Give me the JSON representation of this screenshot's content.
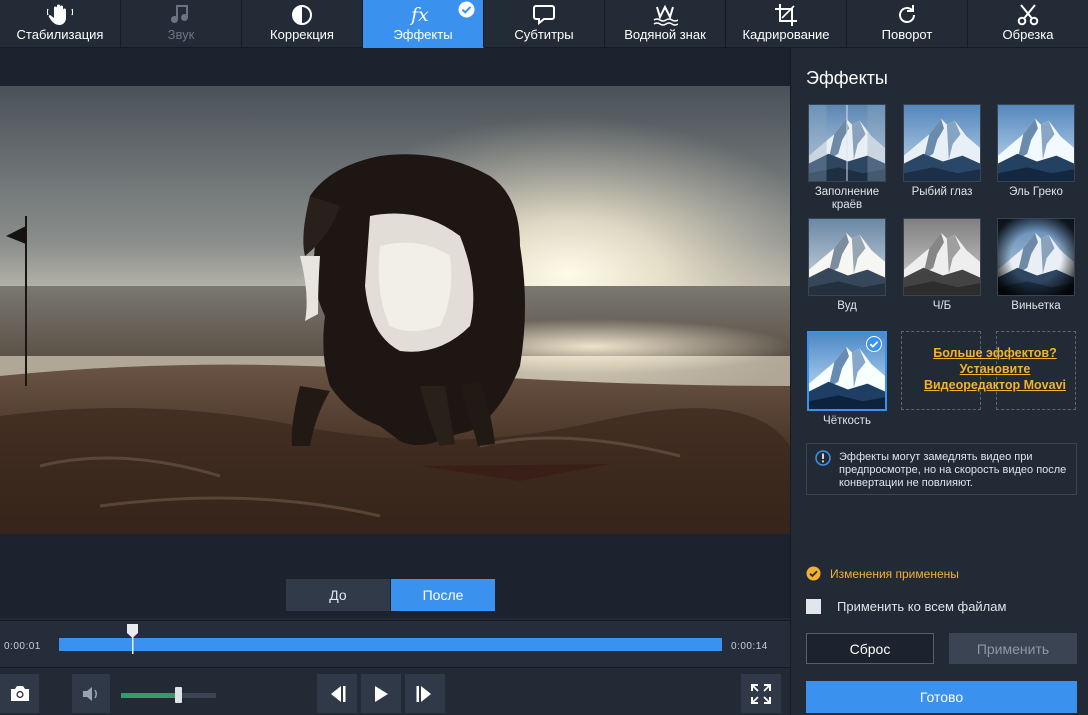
{
  "toolbar": {
    "tabs": [
      {
        "label": "Стабилизация",
        "icon": "hand-icon",
        "state": "normal"
      },
      {
        "label": "Звук",
        "icon": "music-note-icon",
        "state": "disabled"
      },
      {
        "label": "Коррекция",
        "icon": "contrast-icon",
        "state": "normal"
      },
      {
        "label": "Эффекты",
        "icon": "fx-icon",
        "state": "active"
      },
      {
        "label": "Субтитры",
        "icon": "speech-bubble-icon",
        "state": "normal"
      },
      {
        "label": "Водяной знак",
        "icon": "watermark-icon",
        "state": "normal"
      },
      {
        "label": "Кадрирование",
        "icon": "crop-icon",
        "state": "normal"
      },
      {
        "label": "Поворот",
        "icon": "rotate-icon",
        "state": "normal"
      },
      {
        "label": "Обрезка",
        "icon": "scissors-icon",
        "state": "normal"
      }
    ]
  },
  "preview": {
    "before_label": "До",
    "after_label": "После"
  },
  "timeline": {
    "time_start": "0:00:01",
    "time_end": "0:00:14",
    "playhead_fraction": 0.11
  },
  "controls": {
    "volume_fraction": 0.6
  },
  "panel": {
    "title": "Эффекты",
    "effects": [
      {
        "label": "Заполнение краёв",
        "selected": false
      },
      {
        "label": "Рыбий глаз",
        "selected": false
      },
      {
        "label": "Эль Греко",
        "selected": false
      },
      {
        "label": "Вуд",
        "selected": false
      },
      {
        "label": "Ч/Б",
        "selected": false
      },
      {
        "label": "Виньетка",
        "selected": false
      },
      {
        "label": "Чёткость",
        "selected": true
      }
    ],
    "more_effects_line1": "Больше эффектов?",
    "more_effects_line2": "Установите",
    "more_effects_line3": "Видеоредактор Movavi",
    "info_text": "Эффекты могут замедлять видео при предпросмотре, но на скорость видео после конвертации не повлияют.",
    "applied_status": "Изменения применены",
    "apply_all_label": "Применить ко всем файлам",
    "reset_label": "Сброс",
    "apply_label": "Применить",
    "done_label": "Готово"
  },
  "colors": {
    "accent": "#3a92ee",
    "status": "#f3b22c",
    "panel_bg": "#222a36"
  }
}
